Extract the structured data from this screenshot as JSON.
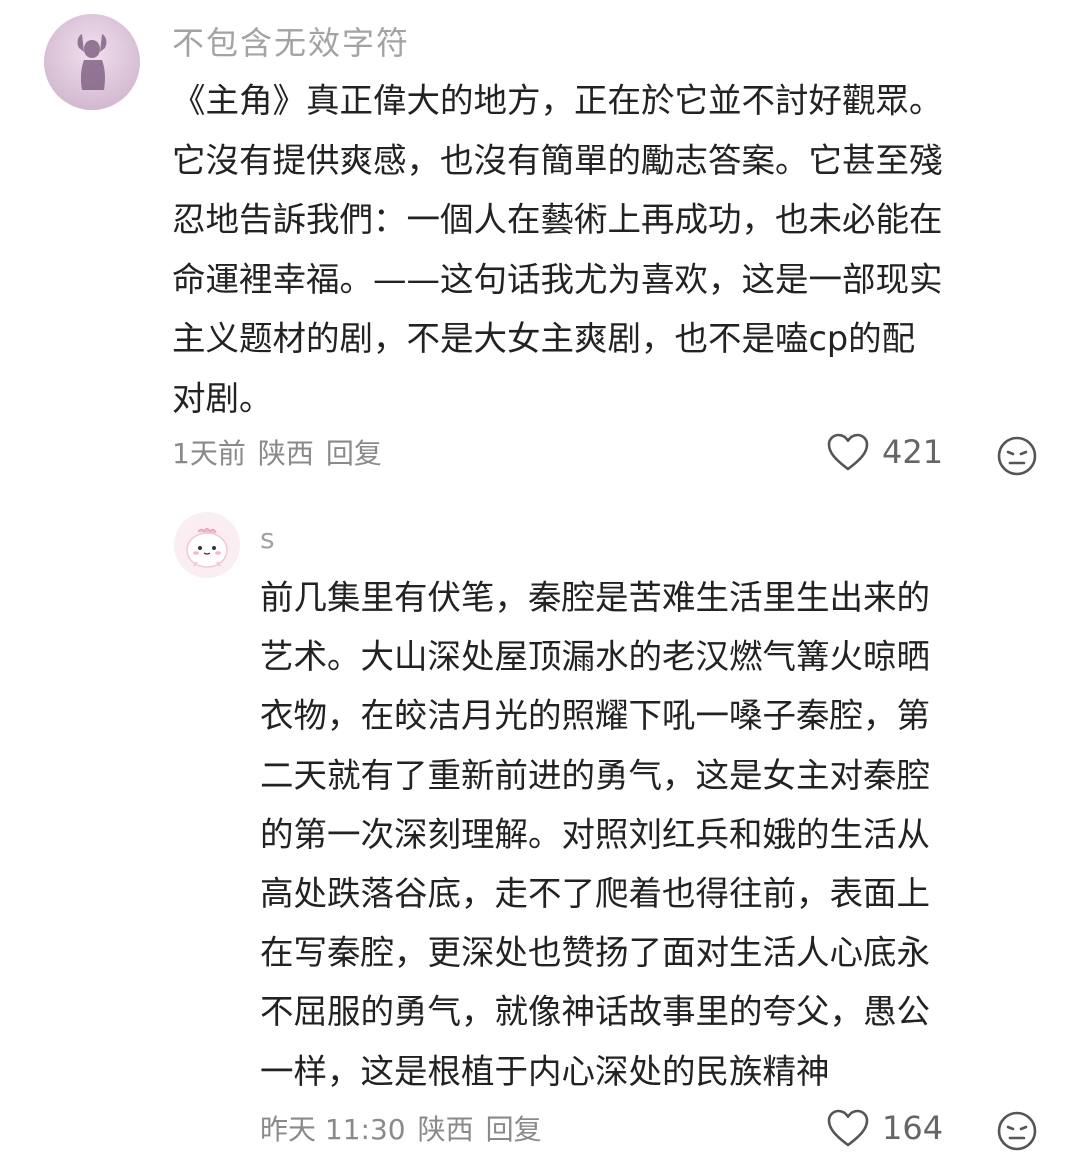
{
  "comments": [
    {
      "username": "不包含无效字符",
      "avatar_icon": "silhouette-avatar",
      "lines": [
        "《主角》真正偉大的地方，正在於它並不討好觀眾。",
        "它沒有提供爽感，也沒有簡單的勵志答案。它甚至殘",
        "忍地告訴我們：一個人在藝術上再成功，也未必能在",
        "命運裡幸福。——这句话我尤为喜欢，这是一部现实",
        "主义题材的剧，不是大女主爽剧，也不是嗑cp的配",
        "对剧。"
      ],
      "time": "1天前",
      "location": "陕西",
      "reply_label": "回复",
      "likes": "421",
      "icons": {
        "like": "heart-outline-icon",
        "react": "meh-face-icon"
      }
    },
    {
      "username": "s",
      "avatar_icon": "cartoon-dinosaur-avatar",
      "lines": [
        "前几集里有伏笔，秦腔是苦难生活里生出来的",
        "艺术。大山深处屋顶漏水的老汉燃气篝火晾晒",
        "衣物，在皎洁月光的照耀下吼一嗓子秦腔，第",
        "二天就有了重新前进的勇气，这是女主对秦腔",
        "的第一次深刻理解。对照刘红兵和娥的生活从",
        "高处跌落谷底，走不了爬着也得往前，表面上",
        "在写秦腔，更深处也赞扬了面对生活人心底永",
        "不屈服的勇气，就像神话故事里的夸父，愚公",
        "一样，这是根植于内心深处的民族精神"
      ],
      "time": "昨天 11:30",
      "location": "陕西",
      "reply_label": "回复",
      "likes": "164",
      "icons": {
        "like": "heart-outline-icon",
        "react": "meh-face-icon"
      }
    }
  ],
  "colors": {
    "meta": "#8a8a8a",
    "username": "#a3a3a3",
    "text": "#222222"
  }
}
